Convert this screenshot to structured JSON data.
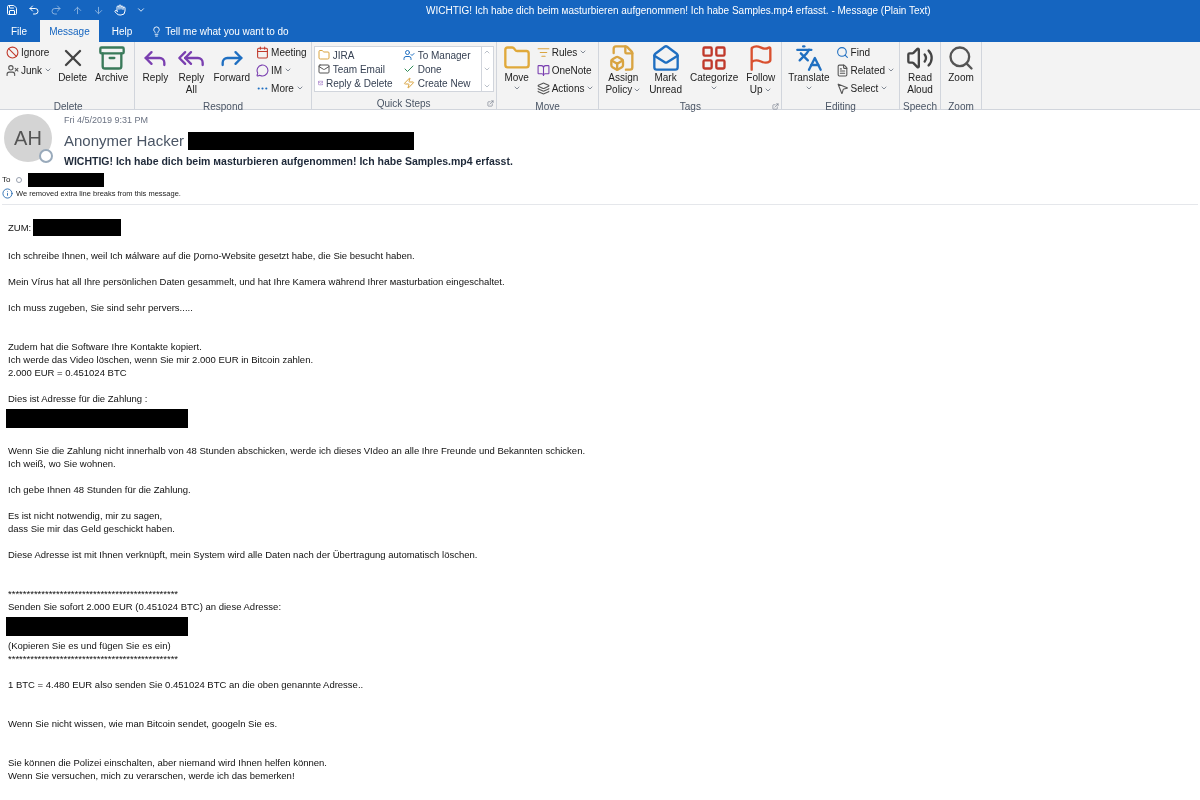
{
  "window": {
    "title": "WICHTIG! Ich habe dich beim мasturbieren aufgenommen! Ich habe Samples.mp4 erfasst.  -  Message (Plain Text)"
  },
  "tabs": [
    {
      "label": "File",
      "selected": false
    },
    {
      "label": "Message",
      "selected": true
    },
    {
      "label": "Help",
      "selected": false
    }
  ],
  "tell_me": {
    "placeholder": "Tell me what you want to do"
  },
  "ribbon": [
    {
      "label": "Delete",
      "columns": [
        {
          "kind": "stack",
          "items": [
            {
              "label": "Ignore",
              "dropdown": false
            },
            {
              "label": "Junk",
              "dropdown": true
            }
          ]
        },
        {
          "kind": "large",
          "lines": [
            "Delete"
          ],
          "dropdown": false
        },
        {
          "kind": "large",
          "lines": [
            "Archive"
          ],
          "dropdown": false
        }
      ]
    },
    {
      "label": "Respond",
      "columns": [
        {
          "kind": "large",
          "lines": [
            "Reply"
          ],
          "dropdown": false
        },
        {
          "kind": "large",
          "lines": [
            "Reply",
            "All"
          ],
          "dropdown": false
        },
        {
          "kind": "large",
          "lines": [
            "Forward"
          ],
          "dropdown": false
        },
        {
          "kind": "stack",
          "items": [
            {
              "label": "Meeting",
              "dropdown": false
            },
            {
              "label": "IM",
              "dropdown": true
            },
            {
              "label": "More",
              "dropdown": true
            }
          ]
        }
      ]
    },
    {
      "label": "Quick Steps",
      "launcher": true,
      "columns": [
        {
          "kind": "gallery",
          "items": [
            {
              "label": "JIRA"
            },
            {
              "label": "To Manager"
            },
            {
              "label": "Team Email"
            },
            {
              "label": "Done"
            },
            {
              "label": "Reply & Delete"
            },
            {
              "label": "Create New"
            }
          ]
        }
      ]
    },
    {
      "label": "Move",
      "columns": [
        {
          "kind": "large",
          "lines": [
            "Move"
          ],
          "dropdown": true
        },
        {
          "kind": "stack",
          "items": [
            {
              "label": "Rules",
              "dropdown": true
            },
            {
              "label": "OneNote",
              "dropdown": false
            },
            {
              "label": "Actions",
              "dropdown": true
            }
          ]
        }
      ]
    },
    {
      "label": "Tags",
      "launcher": true,
      "columns": [
        {
          "kind": "large",
          "lines": [
            "Assign",
            "Policy"
          ],
          "dropdown": true
        },
        {
          "kind": "large",
          "lines": [
            "Mark",
            "Unread"
          ],
          "dropdown": false
        },
        {
          "kind": "large",
          "lines": [
            "Categorize"
          ],
          "dropdown": true
        },
        {
          "kind": "large",
          "lines": [
            "Follow",
            "Up"
          ],
          "dropdown": true
        }
      ]
    },
    {
      "label": "Editing",
      "columns": [
        {
          "kind": "large",
          "lines": [
            "Translate"
          ],
          "dropdown": true
        },
        {
          "kind": "stack",
          "items": [
            {
              "label": "Find",
              "dropdown": false
            },
            {
              "label": "Related",
              "dropdown": true
            },
            {
              "label": "Select",
              "dropdown": true
            }
          ]
        }
      ]
    },
    {
      "label": "Speech",
      "columns": [
        {
          "kind": "large",
          "lines": [
            "Read",
            "Aloud"
          ],
          "dropdown": false
        }
      ]
    },
    {
      "label": "Zoom",
      "columns": [
        {
          "kind": "large",
          "lines": [
            "Zoom"
          ],
          "dropdown": false
        }
      ]
    }
  ],
  "message": {
    "date": "Fri 4/5/2019 9:31 PM",
    "initials": "AH",
    "sender": "Anonymer Hacker",
    "subject": "WICHTIG! Ich habe dich beim мasturbieren aufgenommen! Ich habe Samples.mp4 erfasst.",
    "to_label": "To",
    "info": "We removed extra line breaks from this message."
  },
  "body": [
    {
      "kind": "labelled",
      "text": "ZUM:"
    },
    {
      "kind": "blank"
    },
    {
      "kind": "line",
      "text": "Ich schreibe Ihnen, weil Ich мálware auf die Ƿorno-Website gesetzt habe, die Sie besucht haben."
    },
    {
      "kind": "blank"
    },
    {
      "kind": "line",
      "text": "Mein Vírus hat all Ihre persönlichen Daten gesammelt, und hat Ihre Kamera während Ihrer мasturbation eingeschaltet."
    },
    {
      "kind": "blank"
    },
    {
      "kind": "line",
      "text": "Ich muss zugeben, Sie sind sehr pervers....."
    },
    {
      "kind": "blank"
    },
    {
      "kind": "blank"
    },
    {
      "kind": "line",
      "text": "Zudem hat die Software Ihre Kontakte kopiert."
    },
    {
      "kind": "line",
      "text": "Ich werde das Video löschen, wenn Sie mir 2.000 EUR in Bitcoin zahlen."
    },
    {
      "kind": "line",
      "text": "2.000 EUR = 0.451024 BTC"
    },
    {
      "kind": "blank"
    },
    {
      "kind": "line",
      "text": "Dies ist Adresse für die Zahlung :"
    },
    {
      "kind": "redacted"
    },
    {
      "kind": "blank"
    },
    {
      "kind": "line",
      "text": "Wenn Sie die Zahlung nicht innerhalb von 48 Stunden abschicken, werde ich dieses VIdeo an alle Ihre Freunde und Bekannten schicken."
    },
    {
      "kind": "line",
      "text": "Ich weiß, wo Sie wohnen."
    },
    {
      "kind": "blank"
    },
    {
      "kind": "line",
      "text": "Ich gebe Ihnen 48 Stunden für die Zahlung."
    },
    {
      "kind": "blank"
    },
    {
      "kind": "line",
      "text": "Es ist nicht notwendig, mir zu sagen,"
    },
    {
      "kind": "line",
      "text": "dass Sie mir das Geld geschickt haben."
    },
    {
      "kind": "blank"
    },
    {
      "kind": "line",
      "text": "Diese Adresse ist mit Ihnen verknüpft, mein System wird alle Daten nach der Übertragung automatisch löschen."
    },
    {
      "kind": "blank"
    },
    {
      "kind": "blank"
    },
    {
      "kind": "line",
      "text": "**********************************************"
    },
    {
      "kind": "line",
      "text": "Senden Sie sofort 2.000 EUR (0.451024 BTC) an diese Adresse:"
    },
    {
      "kind": "redacted"
    },
    {
      "kind": "line",
      "text": "(Kopieren Sie es und fügen Sie es ein)"
    },
    {
      "kind": "line",
      "text": "**********************************************"
    },
    {
      "kind": "blank"
    },
    {
      "kind": "line",
      "text": "1 BTC = 4.480 EUR also senden Sie 0.451024 BTC an die oben genannte Adresse.."
    },
    {
      "kind": "blank"
    },
    {
      "kind": "blank"
    },
    {
      "kind": "line",
      "text": "Wenn Sie nicht wissen, wie man Bitcoin sendet, googeln Sie es."
    },
    {
      "kind": "blank"
    },
    {
      "kind": "blank"
    },
    {
      "kind": "line",
      "text": "Sie können die Polizei einschalten, aber niemand wird Ihnen helfen können."
    },
    {
      "kind": "line",
      "text": "Wenn Sie versuchen, mich zu verarschen, werde ich das bemerken!"
    }
  ]
}
